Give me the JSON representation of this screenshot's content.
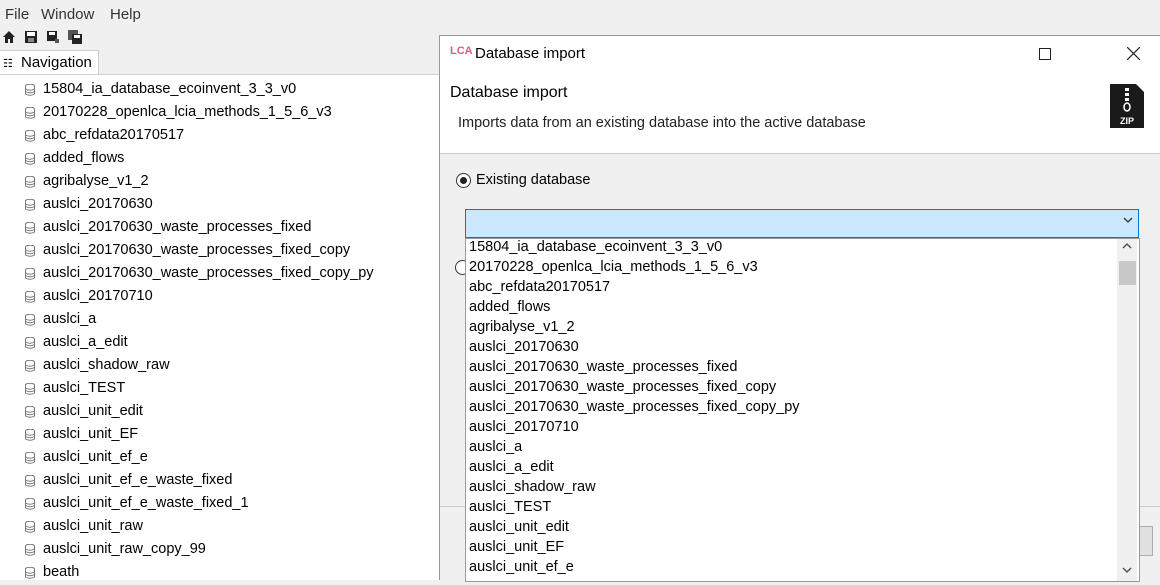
{
  "menu": {
    "file": "File",
    "window": "Window",
    "help": "Help"
  },
  "toolbar": {
    "icons": [
      "home-icon",
      "save-icon",
      "save-as-icon",
      "save-all-icon"
    ]
  },
  "navigation": {
    "tab_label": "Navigation",
    "items": [
      "15804_ia_database_ecoinvent_3_3_v0",
      "20170228_openlca_lcia_methods_1_5_6_v3",
      "abc_refdata20170517",
      "added_flows",
      "agribalyse_v1_2",
      "auslci_20170630",
      "auslci_20170630_waste_processes_fixed",
      "auslci_20170630_waste_processes_fixed_copy",
      "auslci_20170630_waste_processes_fixed_copy_py",
      "auslci_20170710",
      "auslci_a",
      "auslci_a_edit",
      "auslci_shadow_raw",
      "auslci_TEST",
      "auslci_unit_edit",
      "auslci_unit_EF",
      "auslci_unit_ef_e",
      "auslci_unit_ef_e_waste_fixed",
      "auslci_unit_ef_e_waste_fixed_1",
      "auslci_unit_raw",
      "auslci_unit_raw_copy_99",
      "beath"
    ]
  },
  "dialog": {
    "window_title": "Database import",
    "logo_text": "LCA",
    "header_title": "Database import",
    "header_description": "Imports data from an existing database into the active database",
    "zip_icon_text": "ZIP",
    "radio_existing": "Existing database",
    "combo_value": "",
    "dropdown_items": [
      "15804_ia_database_ecoinvent_3_3_v0",
      "20170228_openlca_lcia_methods_1_5_6_v3",
      "abc_refdata20170517",
      "added_flows",
      "agribalyse_v1_2",
      "auslci_20170630",
      "auslci_20170630_waste_processes_fixed",
      "auslci_20170630_waste_processes_fixed_copy",
      "auslci_20170630_waste_processes_fixed_copy_py",
      "auslci_20170710",
      "auslci_a",
      "auslci_a_edit",
      "auslci_shadow_raw",
      "auslci_TEST",
      "auslci_unit_edit",
      "auslci_unit_EF",
      "auslci_unit_ef_e"
    ]
  }
}
